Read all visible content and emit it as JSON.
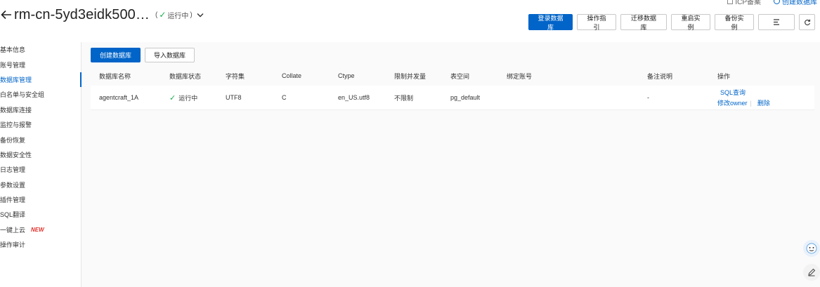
{
  "top_util": {
    "left_label": "ICP备案",
    "right_label": "创建数据库"
  },
  "header": {
    "title": "rm-cn-5yd3eidk500…",
    "status_prefix": "(",
    "status_text": "运行中",
    "status_suffix": ")"
  },
  "actions": {
    "login": "登录数据库",
    "guide": "操作指引",
    "migrate": "迁移数据库",
    "restart": "重启实例",
    "backup": "备份实例"
  },
  "sidebar": {
    "items": [
      {
        "label": "基本信息"
      },
      {
        "label": "账号管理"
      },
      {
        "label": "数据库管理",
        "active": true
      },
      {
        "label": "白名单与安全组"
      },
      {
        "label": "数据库连接"
      },
      {
        "label": "监控与报警"
      },
      {
        "label": "备份恢复"
      },
      {
        "label": "数据安全性"
      },
      {
        "label": "日志管理"
      },
      {
        "label": "参数设置"
      },
      {
        "label": "插件管理"
      },
      {
        "label": "SQL翻译"
      },
      {
        "label": "一键上云",
        "badge": "NEW"
      },
      {
        "label": "操作审计"
      }
    ]
  },
  "main": {
    "create_db": "创建数据库",
    "import_db": "导入数据库",
    "columns": [
      "数据库名称",
      "数据库状态",
      "字符集",
      "Collate",
      "Ctype",
      "限制并发量",
      "表空间",
      "绑定账号",
      "备注说明",
      "操作"
    ],
    "rows": [
      {
        "name": "agentcraft_1A",
        "status": "运行中",
        "charset": "UTF8",
        "collate": "C",
        "ctype": "en_US.utf8",
        "concurrency": "不限制",
        "tablespace": "pg_default",
        "account": "",
        "remark": "-",
        "op_sql": "SQL查询",
        "op_owner": "修改owner",
        "op_delete": "删除"
      }
    ]
  },
  "colors": {
    "primary": "#0064c8",
    "success": "#1eac52",
    "new_badge": "#e3312c"
  }
}
